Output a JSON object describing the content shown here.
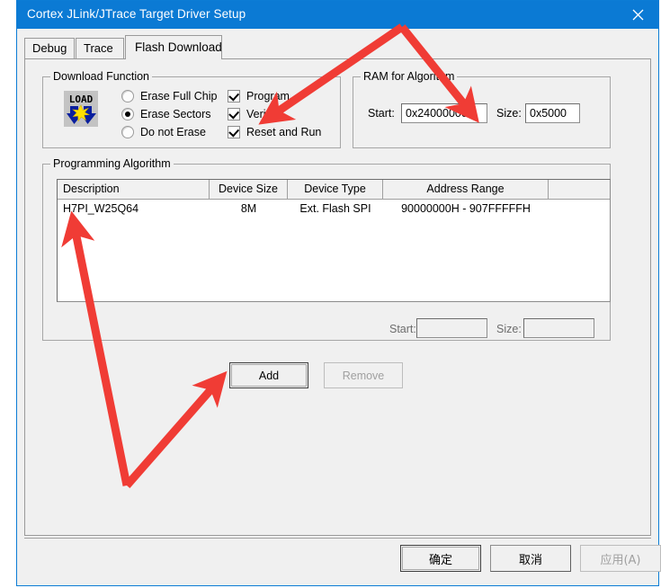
{
  "window": {
    "title": "Cortex JLink/JTrace Target Driver Setup",
    "close_icon": "close-icon"
  },
  "tabs": [
    {
      "label": "Debug",
      "selected": false
    },
    {
      "label": "Trace",
      "selected": false
    },
    {
      "label": "Flash Download",
      "selected": true
    }
  ],
  "download_function": {
    "legend": "Download Function",
    "icon": {
      "name": "load-icon",
      "text": "LOAD"
    },
    "erase_mode": [
      {
        "label": "Erase Full Chip",
        "checked": false
      },
      {
        "label": "Erase Sectors",
        "checked": true
      },
      {
        "label": "Do not Erase",
        "checked": false
      }
    ],
    "options": [
      {
        "label": "Program",
        "checked": true
      },
      {
        "label": "Verify",
        "checked": true
      },
      {
        "label": "Reset and Run",
        "checked": true
      }
    ]
  },
  "ram_for_algorithm": {
    "legend": "RAM for Algorithm",
    "start_label": "Start:",
    "start_value": "0x24000000",
    "size_label": "Size:",
    "size_value": "0x5000"
  },
  "programming_algorithm": {
    "legend": "Programming Algorithm",
    "columns": [
      "Description",
      "Device Size",
      "Device Type",
      "Address Range",
      ""
    ],
    "rows": [
      {
        "description": "H7PI_W25Q64",
        "device_size": "8M",
        "device_type": "Ext. Flash SPI",
        "address_range": "90000000H - 907FFFFFH",
        "extra": ""
      }
    ],
    "start_label": "Start:",
    "start_value": "",
    "size_label": "Size:",
    "size_value": "",
    "add_button": "Add",
    "remove_button": "Remove"
  },
  "footer": {
    "ok_button": "确定",
    "cancel_button": "取消",
    "apply_button": "应用(A)"
  },
  "annotations": {
    "arrow_color": "#f03c35",
    "count": 4
  }
}
